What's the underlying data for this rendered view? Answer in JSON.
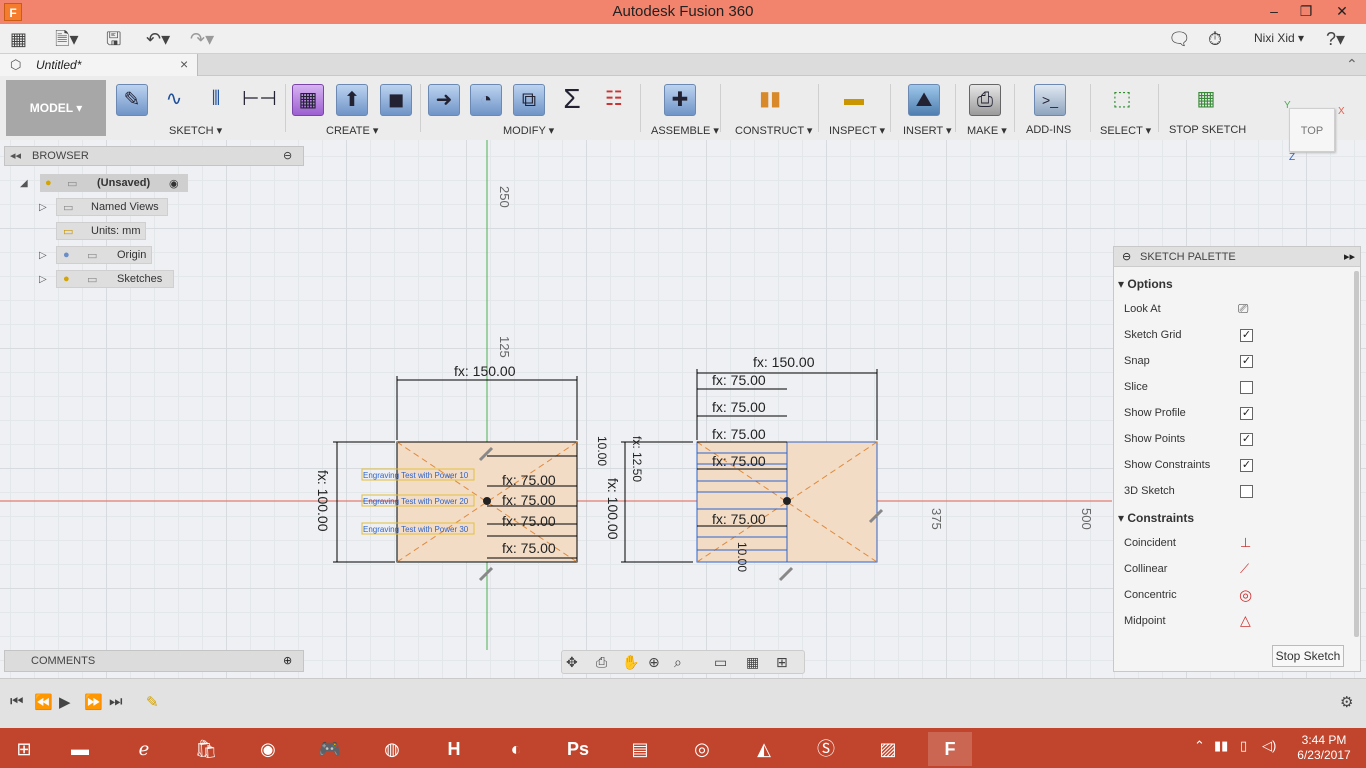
{
  "window": {
    "title": "Autodesk Fusion 360",
    "app_icon": "F",
    "controls": [
      "–",
      "❐",
      "✕"
    ]
  },
  "app_toolbar": {
    "user_name": "Nixi Xid ▾",
    "icons": [
      "grid-menu-icon",
      "file-icon",
      "save-icon",
      "undo-icon",
      "redo-icon",
      "notifications-icon",
      "job-status-icon",
      "help-icon"
    ]
  },
  "document_tab": {
    "label": "Untitled*"
  },
  "ribbon": {
    "workspace": "MODEL ▾",
    "groups": [
      "SKETCH ▾",
      "CREATE ▾",
      "MODIFY ▾",
      "ASSEMBLE ▾",
      "CONSTRUCT ▾",
      "INSPECT ▾",
      "INSERT ▾",
      "MAKE ▾",
      "ADD-INS",
      "SELECT ▾",
      "STOP SKETCH"
    ]
  },
  "browser": {
    "title": "BROWSER",
    "root": "(Unsaved)",
    "nodes": [
      "Named Views",
      "Units: mm",
      "Origin",
      "Sketches"
    ]
  },
  "comments": {
    "title": "COMMENTS"
  },
  "viewcube": {
    "face": "TOP",
    "axis_x": "X",
    "axis_y": "Y",
    "axis_z": "Z"
  },
  "canvas": {
    "rulers": [
      "250",
      "125",
      "375",
      "500"
    ],
    "dims_left": {
      "top_width": "fx: 150.00",
      "left_height": "fx: 100.00",
      "inner": [
        "fx: 75.00",
        "fx: 75.00",
        "fx: 75.00",
        "fx: 75.00"
      ],
      "text_labels": [
        "Engraving Test with Power 10",
        "Engraving Test with Power 20",
        "Engraving Test with Power 30"
      ]
    },
    "dims_right": {
      "top_width": "fx: 150.00",
      "left_height": "fx: 100.00",
      "stacked": [
        "fx: 75.00",
        "fx: 75.00",
        "fx: 75.00",
        "fx: 75.00",
        "fx: 75.00"
      ],
      "small": [
        "fx: 12.50",
        "10.00",
        "10.00"
      ]
    }
  },
  "palette": {
    "title": "SKETCH PALETTE",
    "options_title": "Options",
    "options": [
      {
        "label": "Look At",
        "value": "button"
      },
      {
        "label": "Sketch Grid",
        "value": "✓"
      },
      {
        "label": "Snap",
        "value": "✓"
      },
      {
        "label": "Slice",
        "value": ""
      },
      {
        "label": "Show Profile",
        "value": "✓"
      },
      {
        "label": "Show Points",
        "value": "✓"
      },
      {
        "label": "Show Constraints",
        "value": "✓"
      },
      {
        "label": "3D Sketch",
        "value": ""
      }
    ],
    "constraints_title": "Constraints",
    "constraints": [
      "Coincident",
      "Collinear",
      "Concentric",
      "Midpoint"
    ],
    "stop_button": "Stop Sketch"
  },
  "taskbar": {
    "time": "3:44 PM",
    "date": "6/23/2017"
  },
  "colors": {
    "title_bar": "#f2836d",
    "taskbar": "#c0452c",
    "sketch_fill": "#f2dcc6",
    "dimension_line": "#000000",
    "selected_line": "#2f64c9",
    "red_axis": "#e06050",
    "green_axis": "#4caf50"
  }
}
